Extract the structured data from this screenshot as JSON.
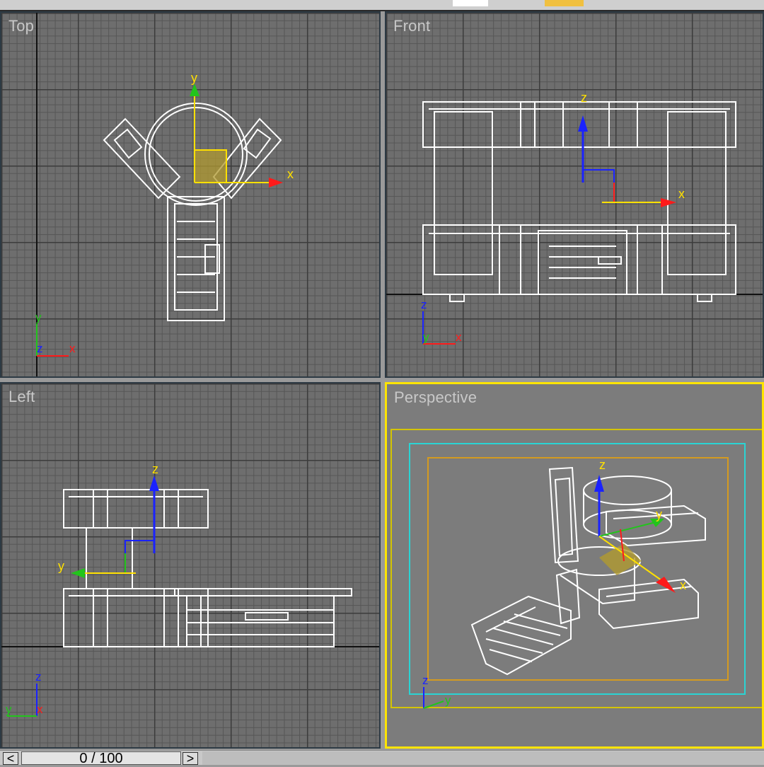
{
  "colors": {
    "grid_bg": "#6e6e6e",
    "perspective_bg": "#7c7c7c",
    "active_border": "#ffe400",
    "axis_x": "#ff1a1a",
    "axis_y": "#22c41c",
    "axis_z": "#1a22ff",
    "gizmo_handle": "#ffe000",
    "safe_frame_outer": "#d4c400",
    "safe_frame_action": "#2ad4d4",
    "safe_frame_title": "#d49a20"
  },
  "viewports": {
    "top": {
      "label": "Top",
      "gizmo": {
        "x": "x",
        "y": "y"
      },
      "corner": {
        "a": "y",
        "b": "z",
        "c": "x"
      }
    },
    "front": {
      "label": "Front",
      "gizmo": {
        "x": "x",
        "z": "z"
      },
      "corner": {
        "a": "z",
        "b": "y",
        "c": "x"
      }
    },
    "left": {
      "label": "Left",
      "gizmo": {
        "y": "y",
        "z": "z"
      },
      "corner": {
        "a": "z",
        "b": "y",
        "c": "x"
      }
    },
    "perspective": {
      "label": "Perspective",
      "active": true,
      "gizmo": {
        "x": "x",
        "y": "y",
        "z": "z"
      },
      "corner": {
        "a": "z",
        "b": "y"
      }
    }
  },
  "timebar": {
    "frame_text": "0 / 100",
    "prev_icon": "chevron-left-icon",
    "next_icon": "chevron-right-icon",
    "prev_glyph": "<",
    "next_glyph": ">"
  }
}
